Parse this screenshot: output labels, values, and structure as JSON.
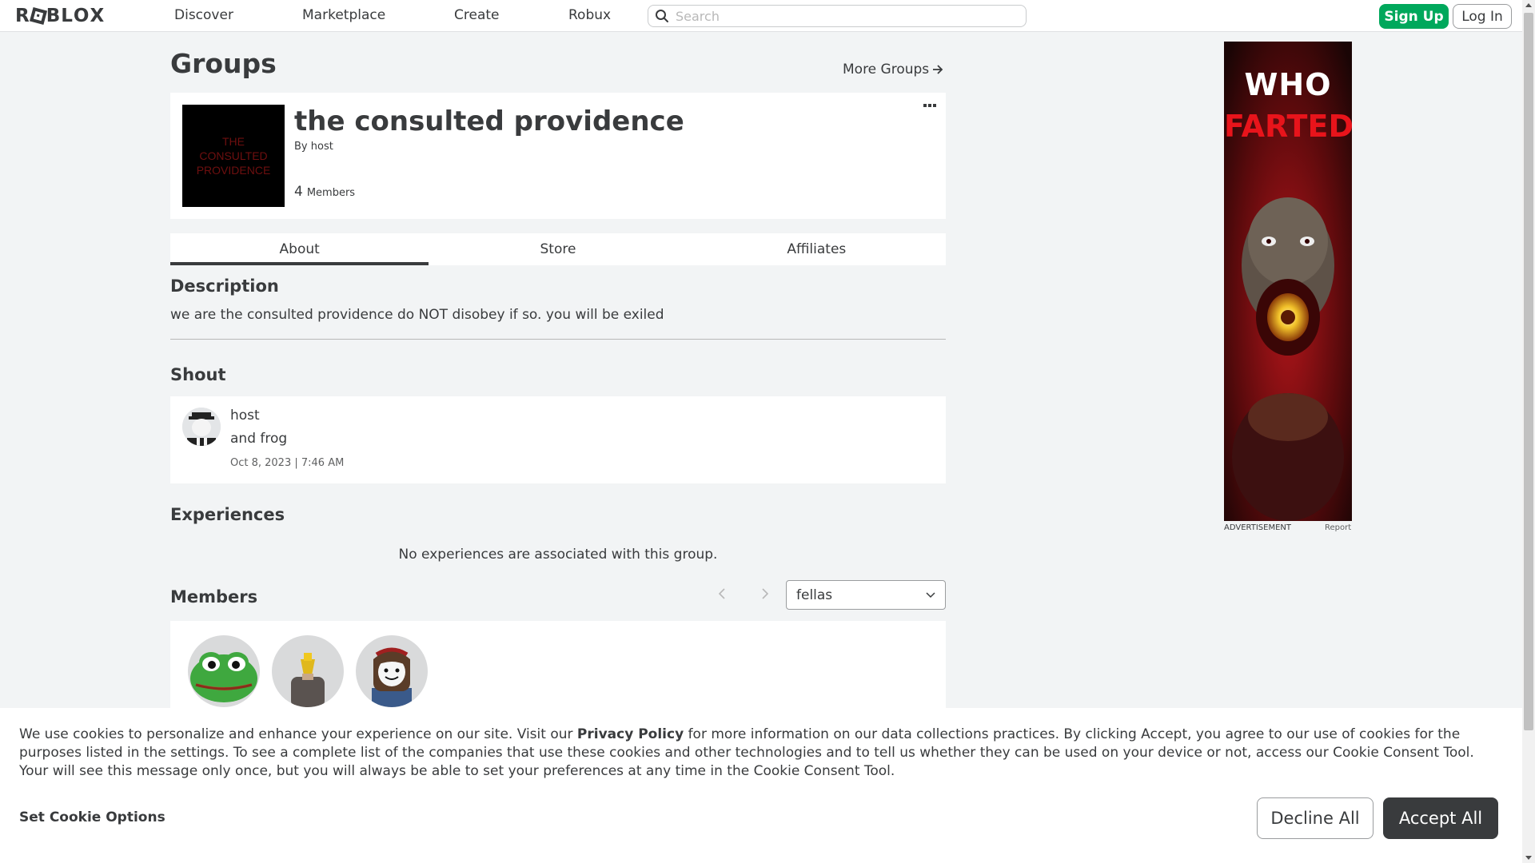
{
  "nav": {
    "logo_text": "ROBLOX",
    "links": [
      "Discover",
      "Marketplace",
      "Create",
      "Robux"
    ],
    "search_placeholder": "Search",
    "signup_label": "Sign Up",
    "login_label": "Log In"
  },
  "page": {
    "title": "Groups",
    "more_groups_label": "More Groups"
  },
  "group": {
    "name": "the consulted providence",
    "by_label": "By",
    "owner": "host",
    "member_count": "4",
    "members_label": "Members",
    "emblem_text": "THE CONSULTED PROVIDENCE"
  },
  "tabs": [
    "About",
    "Store",
    "Affiliates"
  ],
  "active_tab": "About",
  "description": {
    "heading": "Description",
    "text": "we are the consulted providence do NOT disobey if so. you will be exiled"
  },
  "shout": {
    "heading": "Shout",
    "user": "host",
    "body": "and frog",
    "date": "Oct 8, 2023 | 7:46 AM"
  },
  "experiences": {
    "heading": "Experiences",
    "empty_text": "No experiences are associated with this group."
  },
  "members": {
    "heading": "Members",
    "role_selected": "fellas",
    "avatars": [
      "frog-avatar",
      "bald-avatar",
      "brown-hair-avatar"
    ]
  },
  "ad": {
    "line1": "WHO",
    "line2": "FARTED",
    "label": "ADVERTISEMENT",
    "report": "Report"
  },
  "cookie": {
    "text_before": "We use cookies to personalize and enhance your experience on our site. Visit our ",
    "privacy_link": "Privacy Policy",
    "text_after": " for more information on our data collections practices. By clicking Accept, you agree to our use of cookies for the purposes listed in the settings. To see a complete list of the companies that use these cookies and other technologies and to tell us whether they can be used on your device or not, access our Cookie Consent Tool. Your will see this message only once, but you will always be able to set your preferences at any time in the Cookie Consent Tool.",
    "options_label": "Set Cookie Options",
    "decline_label": "Decline All",
    "accept_label": "Accept All"
  },
  "colors": {
    "signup_green": "#00a85c",
    "accept_dark": "#393b3d",
    "page_bg": "#f2f4f5",
    "ad_red": "#e8141b"
  }
}
